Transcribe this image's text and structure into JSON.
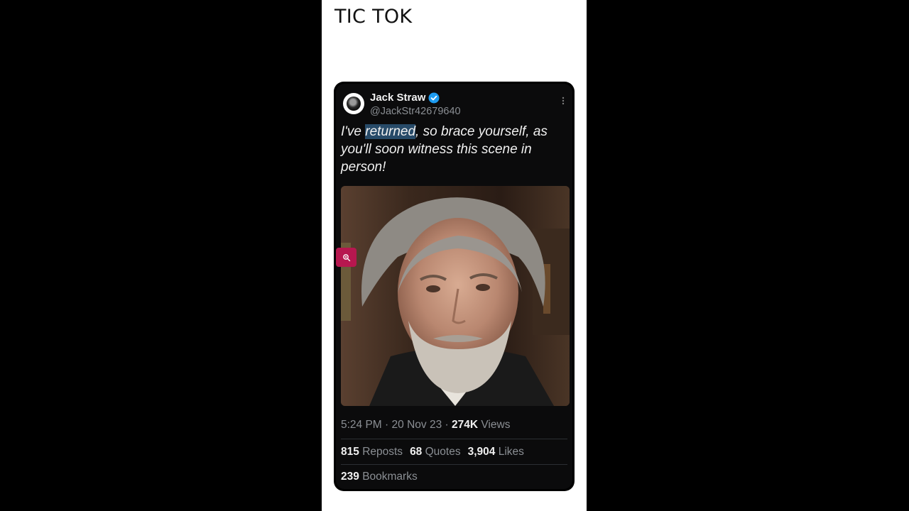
{
  "page": {
    "title": "TIC TOK"
  },
  "tweet": {
    "author_name": "Jack Straw",
    "handle": "@JackStr42679640",
    "text_before": "I've ",
    "text_highlight": "returned",
    "text_after": ", so brace yourself, as you'll soon witness this scene in person!",
    "time": "5:24 PM",
    "separator": "·",
    "date": "20 Nov 23",
    "views_count": "274K",
    "views_label": "Views",
    "reposts_count": "815",
    "reposts_label": "Reposts",
    "quotes_count": "68",
    "quotes_label": "Quotes",
    "likes_count": "3,904",
    "likes_label": "Likes",
    "bookmarks_count": "239",
    "bookmarks_label": "Bookmarks"
  },
  "icons": {
    "verified": "verified-badge-icon",
    "more": "more-options-icon",
    "zoom": "zoom-in-icon",
    "avatar": "avatar"
  },
  "colors": {
    "verified": "#1d9bf0",
    "zoom_button": "#b7174f",
    "highlight": "#274a68"
  }
}
